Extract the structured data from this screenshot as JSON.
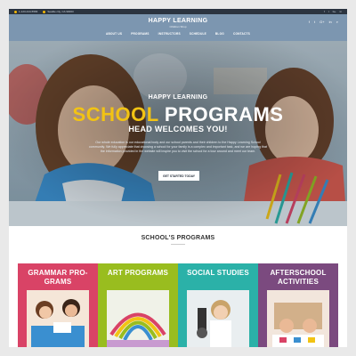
{
  "topbar": {
    "phone": "1-123-444-5566",
    "location": "Seattle city, CA 90003",
    "social": [
      "f",
      "t",
      "G+",
      "in"
    ]
  },
  "header": {
    "brand": "HAPPY LEARNING",
    "tagline": "Children Shop",
    "social": [
      "f",
      "t",
      "G+",
      "in",
      "⌕"
    ]
  },
  "nav": [
    "ABOUT US",
    "PROGRAMS",
    "INSTRUCTORS",
    "SCHEDULE",
    "BLOG",
    "CONTACTS"
  ],
  "hero": {
    "line1": "HAPPY LEARNING",
    "line2a": "SCHOOL",
    "line2b": "PROGRAMS",
    "line3": "HEAD WELCOMES YOU!",
    "body": "Our whole education is our educational body and our school parents and their children to the Happy Learning School community. We fully appreciate that choosing a school for your family is a complex and important task, and we are hoping that the information provided in the website will inspire you to visit the school for a tour around and meet our team.",
    "cta": "GET STARTED TODAY"
  },
  "programs": {
    "title": "SCHOOL'S PROGRAMS",
    "cards": [
      {
        "label": "GRAMMAR PRO-GRAMS",
        "color": "#d94366"
      },
      {
        "label": "ART PROGRAMS",
        "color": "#99bd1f"
      },
      {
        "label": "SOCIAL STUDIES",
        "color": "#2bb1a8"
      },
      {
        "label": "AFTERSCHOOL ACTIVITIES",
        "color": "#7b4a7f"
      }
    ]
  }
}
